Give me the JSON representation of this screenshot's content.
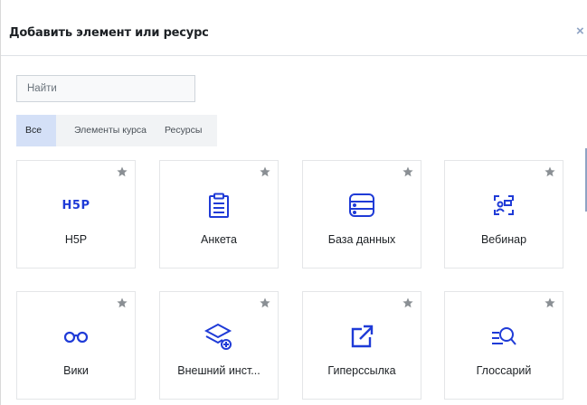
{
  "modal": {
    "title": "Добавить элемент или ресурс",
    "close_symbol": "×"
  },
  "search": {
    "placeholder": "Найти"
  },
  "tabs": [
    {
      "label": "Все",
      "active": true
    },
    {
      "label": "Элементы курса",
      "active": false
    },
    {
      "label": "Ресурсы",
      "active": false
    }
  ],
  "tiles": [
    {
      "label": "H5P",
      "icon": "h5p-icon",
      "icon_text": "H5P"
    },
    {
      "label": "Анкета",
      "icon": "clipboard-icon"
    },
    {
      "label": "База данных",
      "icon": "database-icon"
    },
    {
      "label": "Вебинар",
      "icon": "webinar-icon"
    },
    {
      "label": "Вики",
      "icon": "glasses-icon"
    },
    {
      "label": "Внешний инст...",
      "icon": "layers-plus-icon"
    },
    {
      "label": "Гиперссылка",
      "icon": "external-link-icon"
    },
    {
      "label": "Глоссарий",
      "icon": "list-search-icon"
    }
  ],
  "colors": {
    "accent": "#1f3bd7",
    "star": "#8a8f94",
    "active_tab": "#d4e0f7"
  }
}
